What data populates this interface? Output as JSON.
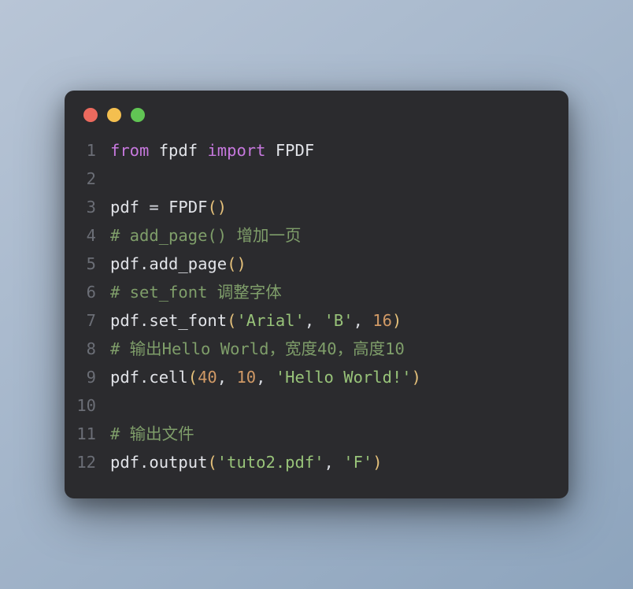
{
  "window": {
    "dots": [
      "red",
      "yellow",
      "green"
    ]
  },
  "code": {
    "lines": [
      {
        "n": "1",
        "tokens": [
          {
            "c": "kw",
            "t": "from"
          },
          {
            "c": "",
            "t": " "
          },
          {
            "c": "ident",
            "t": "fpdf"
          },
          {
            "c": "",
            "t": " "
          },
          {
            "c": "kw",
            "t": "import"
          },
          {
            "c": "",
            "t": " "
          },
          {
            "c": "classname",
            "t": "FPDF"
          }
        ]
      },
      {
        "n": "2",
        "tokens": []
      },
      {
        "n": "3",
        "tokens": [
          {
            "c": "ident",
            "t": "pdf"
          },
          {
            "c": "",
            "t": " "
          },
          {
            "c": "op",
            "t": "="
          },
          {
            "c": "",
            "t": " "
          },
          {
            "c": "fn",
            "t": "FPDF"
          },
          {
            "c": "paren",
            "t": "()"
          }
        ]
      },
      {
        "n": "4",
        "tokens": [
          {
            "c": "cmt",
            "t": "# add_page() 增加一页"
          }
        ]
      },
      {
        "n": "5",
        "tokens": [
          {
            "c": "ident",
            "t": "pdf"
          },
          {
            "c": "op",
            "t": "."
          },
          {
            "c": "fn",
            "t": "add_page"
          },
          {
            "c": "paren",
            "t": "()"
          }
        ]
      },
      {
        "n": "6",
        "tokens": [
          {
            "c": "cmt",
            "t": "# set_font 调整字体"
          }
        ]
      },
      {
        "n": "7",
        "tokens": [
          {
            "c": "ident",
            "t": "pdf"
          },
          {
            "c": "op",
            "t": "."
          },
          {
            "c": "fn",
            "t": "set_font"
          },
          {
            "c": "paren",
            "t": "("
          },
          {
            "c": "str",
            "t": "'Arial'"
          },
          {
            "c": "op",
            "t": ", "
          },
          {
            "c": "str",
            "t": "'B'"
          },
          {
            "c": "op",
            "t": ", "
          },
          {
            "c": "num",
            "t": "16"
          },
          {
            "c": "paren",
            "t": ")"
          }
        ]
      },
      {
        "n": "8",
        "tokens": [
          {
            "c": "cmt",
            "t": "# 输出Hello World，宽度40，高度10"
          }
        ]
      },
      {
        "n": "9",
        "tokens": [
          {
            "c": "ident",
            "t": "pdf"
          },
          {
            "c": "op",
            "t": "."
          },
          {
            "c": "fn",
            "t": "cell"
          },
          {
            "c": "paren",
            "t": "("
          },
          {
            "c": "num",
            "t": "40"
          },
          {
            "c": "op",
            "t": ", "
          },
          {
            "c": "num",
            "t": "10"
          },
          {
            "c": "op",
            "t": ", "
          },
          {
            "c": "str",
            "t": "'Hello World!'"
          },
          {
            "c": "paren",
            "t": ")"
          }
        ]
      },
      {
        "n": "10",
        "tokens": []
      },
      {
        "n": "11",
        "tokens": [
          {
            "c": "cmt",
            "t": "# 输出文件"
          }
        ]
      },
      {
        "n": "12",
        "tokens": [
          {
            "c": "ident",
            "t": "pdf"
          },
          {
            "c": "op",
            "t": "."
          },
          {
            "c": "fn",
            "t": "output"
          },
          {
            "c": "paren",
            "t": "("
          },
          {
            "c": "str",
            "t": "'tuto2.pdf'"
          },
          {
            "c": "op",
            "t": ", "
          },
          {
            "c": "str",
            "t": "'F'"
          },
          {
            "c": "paren",
            "t": ")"
          }
        ]
      }
    ]
  }
}
